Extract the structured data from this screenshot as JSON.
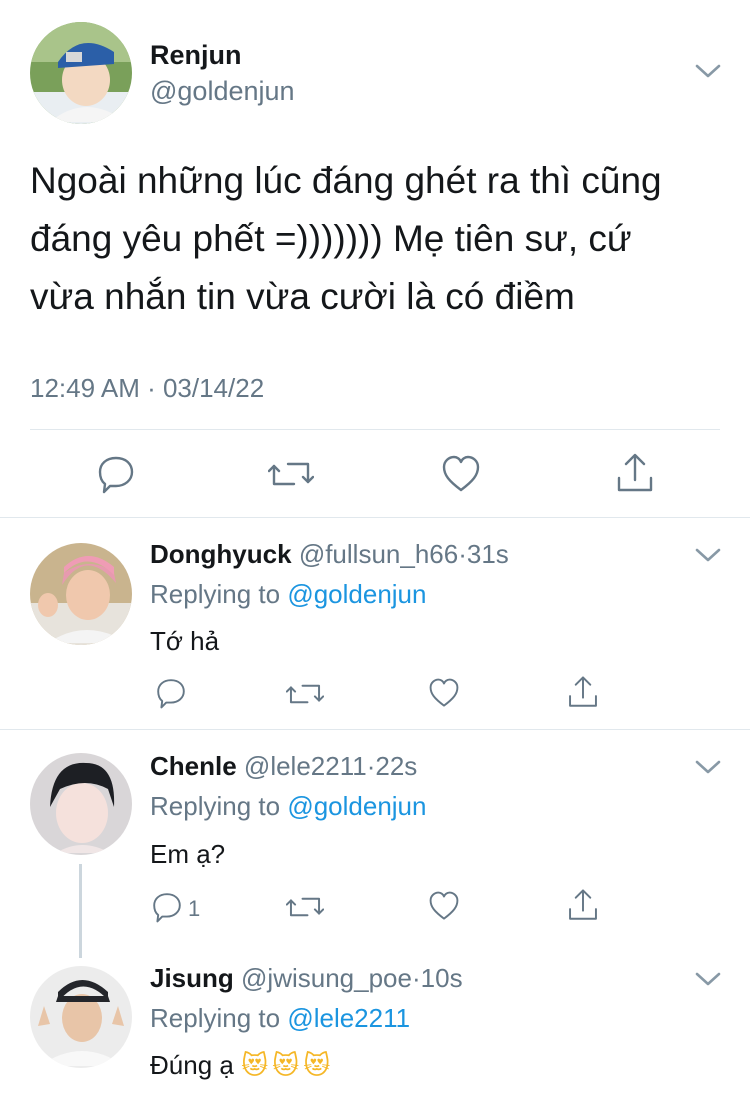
{
  "main_tweet": {
    "name": "Renjun",
    "handle": "@goldenjun",
    "text_lines": [
      "Ngoài những lúc đáng ghét ra thì cũng",
      "đáng yêu phết =))))))) Mẹ tiên sư, cứ",
      "vừa nhắn tin vừa cười là có điềm"
    ],
    "timestamp": "12:49 AM · 03/14/22"
  },
  "replies": [
    {
      "name": "Donghyuck",
      "handle": "@fullsun_h66",
      "sep": "·",
      "time": "31s",
      "replying_label": "Replying to",
      "replying_to": "@goldenjun",
      "text": "Tớ hả",
      "reply_count": ""
    },
    {
      "name": "Chenle",
      "handle": "@lele2211",
      "sep": "·",
      "time": "22s",
      "replying_label": "Replying to",
      "replying_to": "@goldenjun",
      "text": "Em ạ?",
      "reply_count": "1"
    },
    {
      "name": "Jisung",
      "handle": "@jwisung_poe",
      "sep": "·",
      "time": "10s",
      "replying_label": "Replying to",
      "replying_to": "@lele2211",
      "text": "Đúng ạ",
      "emojis": "😻😻😻"
    }
  ],
  "icons": {
    "reply": "reply-icon",
    "retweet": "retweet-icon",
    "like": "heart-icon",
    "share": "share-icon",
    "more": "chevron-down-icon"
  },
  "colors": {
    "text": "#14171a",
    "secondary": "#657786",
    "link": "#1b95e0",
    "divider": "#e1e8ed"
  }
}
